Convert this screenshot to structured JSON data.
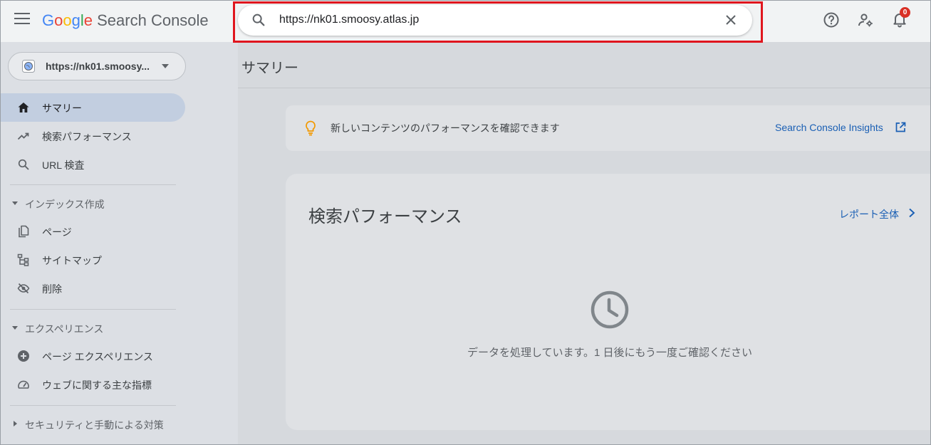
{
  "header": {
    "logo_google": [
      "G",
      "o",
      "o",
      "g",
      "l",
      "e"
    ],
    "logo_product": " Search Console",
    "search_value": "https://nk01.smoosy.atlas.jp",
    "notification_count": "0"
  },
  "sidebar": {
    "property": "https://nk01.smoosy...",
    "items": [
      {
        "label": "サマリー",
        "icon": "home-icon",
        "active": true
      },
      {
        "label": "検索パフォーマンス",
        "icon": "trending-up-icon"
      },
      {
        "label": "URL 検査",
        "icon": "search-icon"
      }
    ],
    "sections": [
      {
        "label": "インデックス作成",
        "items": [
          {
            "label": "ページ",
            "icon": "pages-icon"
          },
          {
            "label": "サイトマップ",
            "icon": "sitemap-icon"
          },
          {
            "label": "削除",
            "icon": "visibility-off-icon"
          }
        ]
      },
      {
        "label": "エクスペリエンス",
        "items": [
          {
            "label": "ページ エクスペリエンス",
            "icon": "plus-circle-icon"
          },
          {
            "label": "ウェブに関する主な指標",
            "icon": "speed-icon"
          }
        ]
      },
      {
        "label": "セキュリティと手動による対策",
        "collapsed": true
      }
    ]
  },
  "main": {
    "title": "サマリー",
    "insight": {
      "text": "新しいコンテンツのパフォーマンスを確認できます",
      "link": "Search Console Insights"
    },
    "performance": {
      "title": "検索パフォーマンス",
      "link": "レポート全体",
      "message": "データを処理しています。1 日後にもう一度ご確認ください"
    }
  },
  "colors": {
    "highlight": "#e0161e",
    "link": "#1a5fb4",
    "active_nav": "#c2cee0",
    "badge": "#d93025"
  }
}
